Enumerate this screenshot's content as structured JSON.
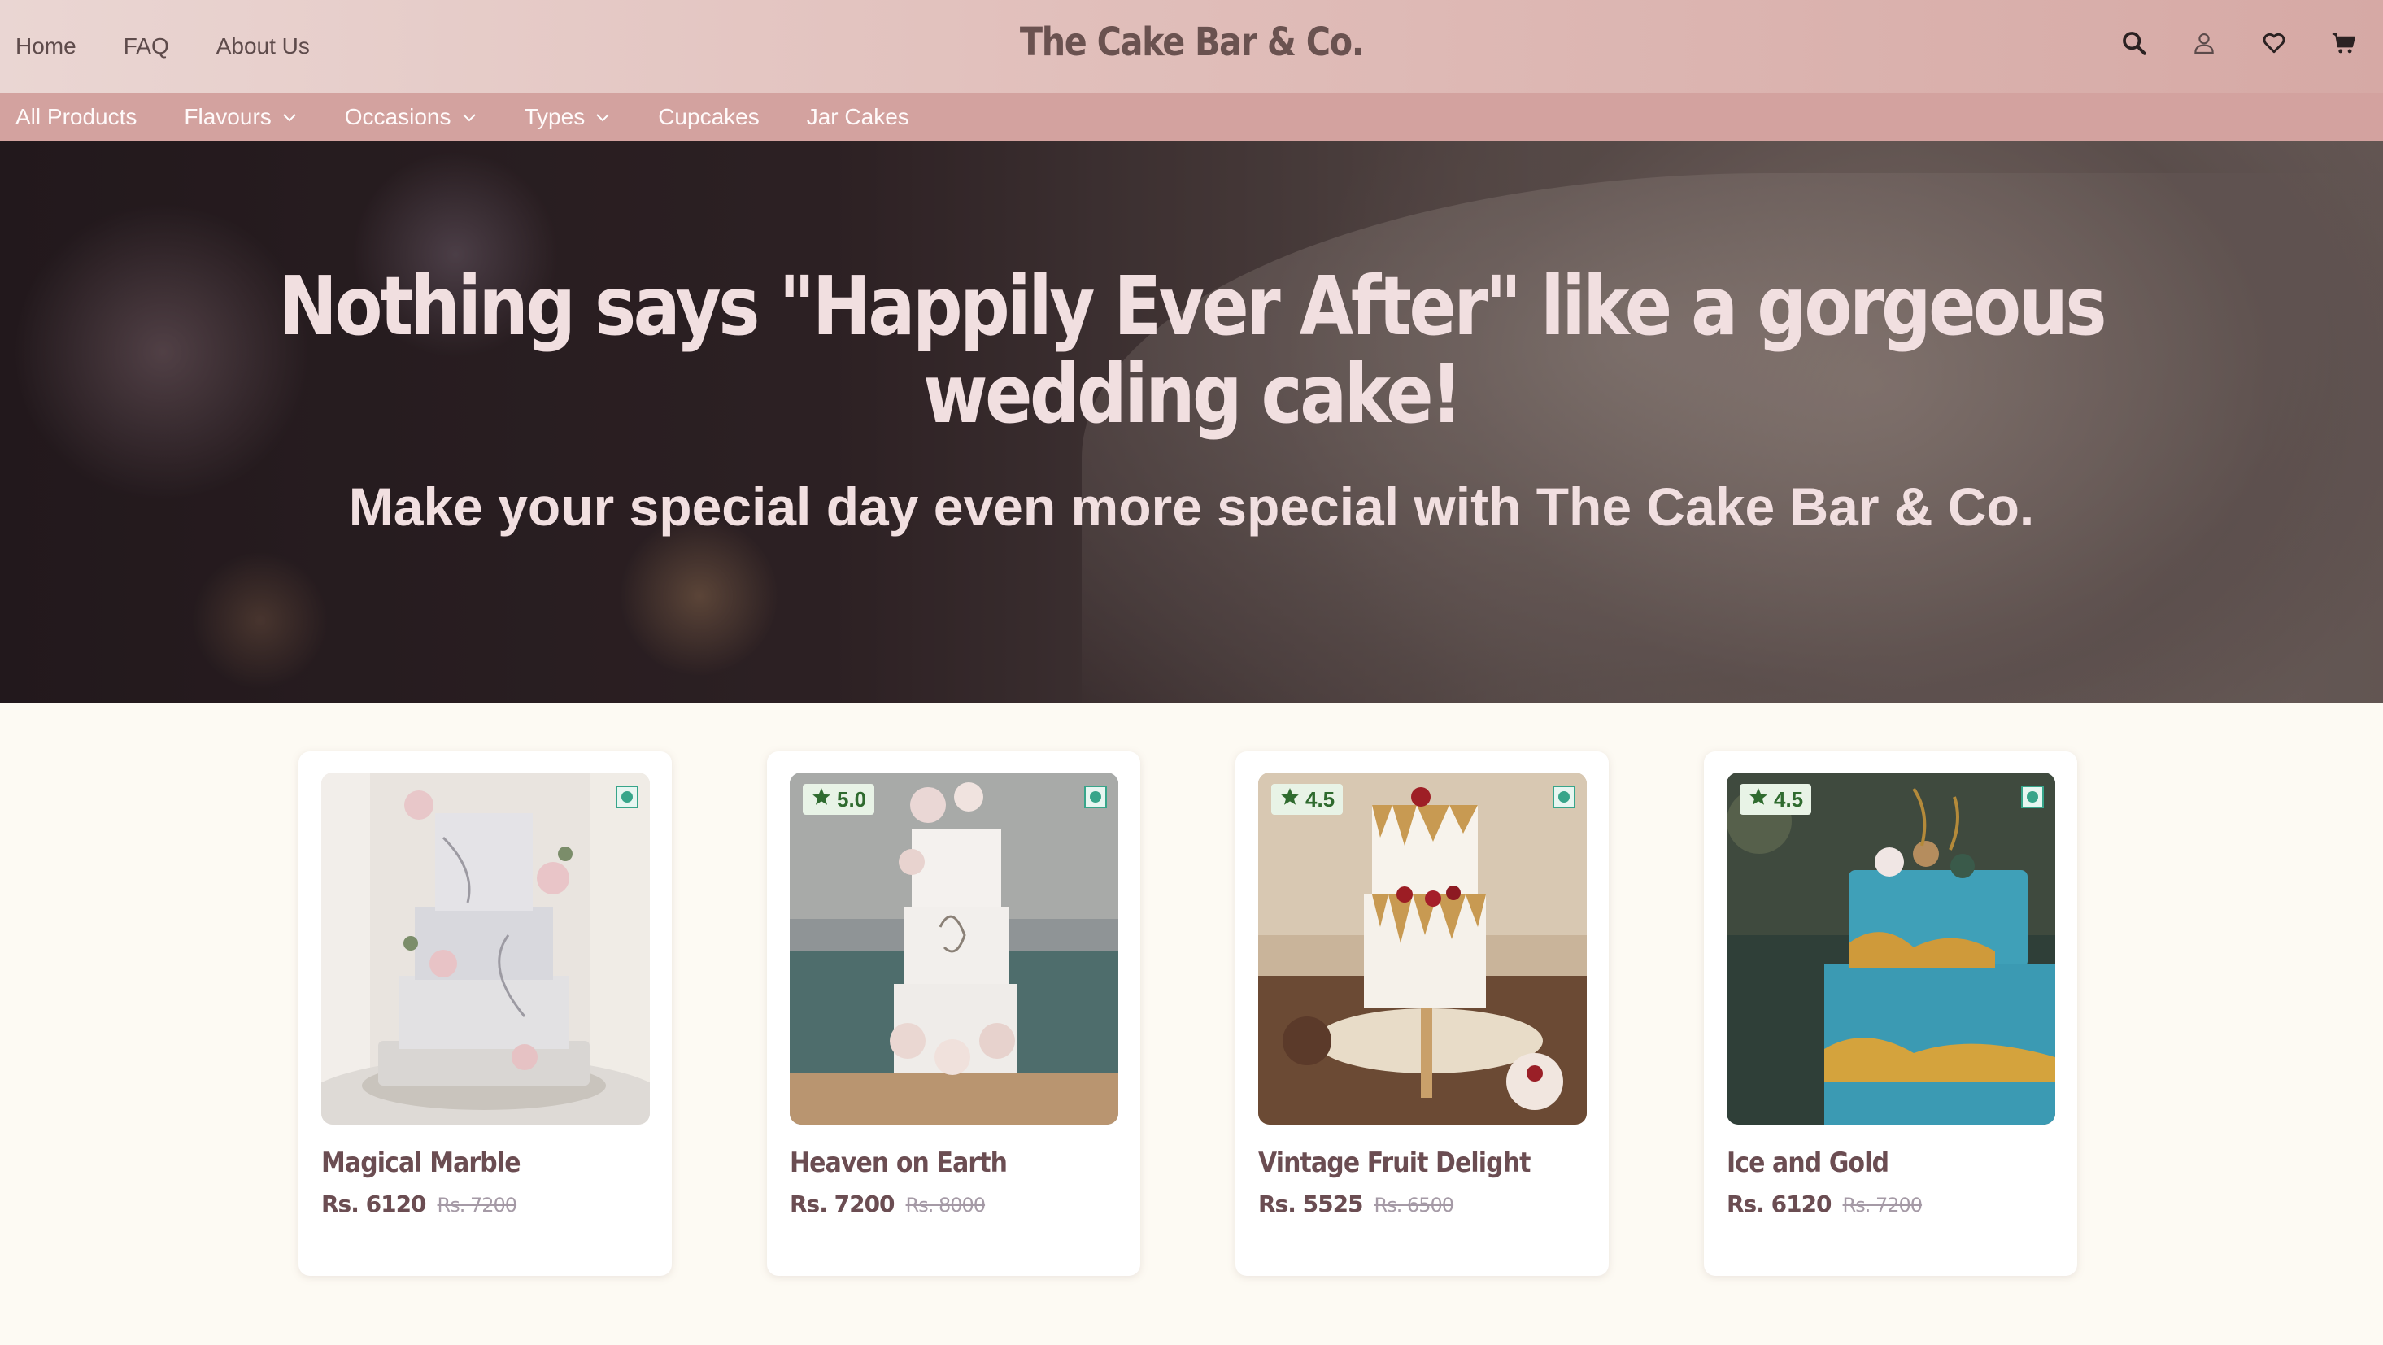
{
  "topnav": [
    "Home",
    "FAQ",
    "About Us"
  ],
  "brand": "The Cake Bar & Co.",
  "icons": [
    "search-icon",
    "user-icon",
    "heart-icon",
    "cart-icon"
  ],
  "subnav": [
    {
      "label": "All Products",
      "dropdown": false
    },
    {
      "label": "Flavours",
      "dropdown": true
    },
    {
      "label": "Occasions",
      "dropdown": true
    },
    {
      "label": "Types",
      "dropdown": true
    },
    {
      "label": "Cupcakes",
      "dropdown": false
    },
    {
      "label": "Jar Cakes",
      "dropdown": false
    }
  ],
  "hero": {
    "headline": "Nothing says \"Happily Ever After\" like a gorgeous wedding cake!",
    "subheadline": "Make your special day even more special with The Cake Bar & Co."
  },
  "products": [
    {
      "name": "Magical Marble",
      "rating": "",
      "price": "Rs. 6120",
      "original_price": "Rs. 7200",
      "veg": true
    },
    {
      "name": "Heaven on Earth",
      "rating": "5.0",
      "price": "Rs. 7200",
      "original_price": "Rs. 8000",
      "veg": true
    },
    {
      "name": "Vintage Fruit Delight",
      "rating": "4.5",
      "price": "Rs. 5525",
      "original_price": "Rs. 6500",
      "veg": true
    },
    {
      "name": "Ice and Gold",
      "rating": "4.5",
      "price": "Rs. 6120",
      "original_price": "Rs. 7200",
      "veg": true
    }
  ],
  "colors": {
    "header": "#e1bfbb",
    "subnav": "#d3a29f",
    "page": "#fdfaf3",
    "veg": "#37a58a",
    "rating": "#2f6b2f"
  }
}
